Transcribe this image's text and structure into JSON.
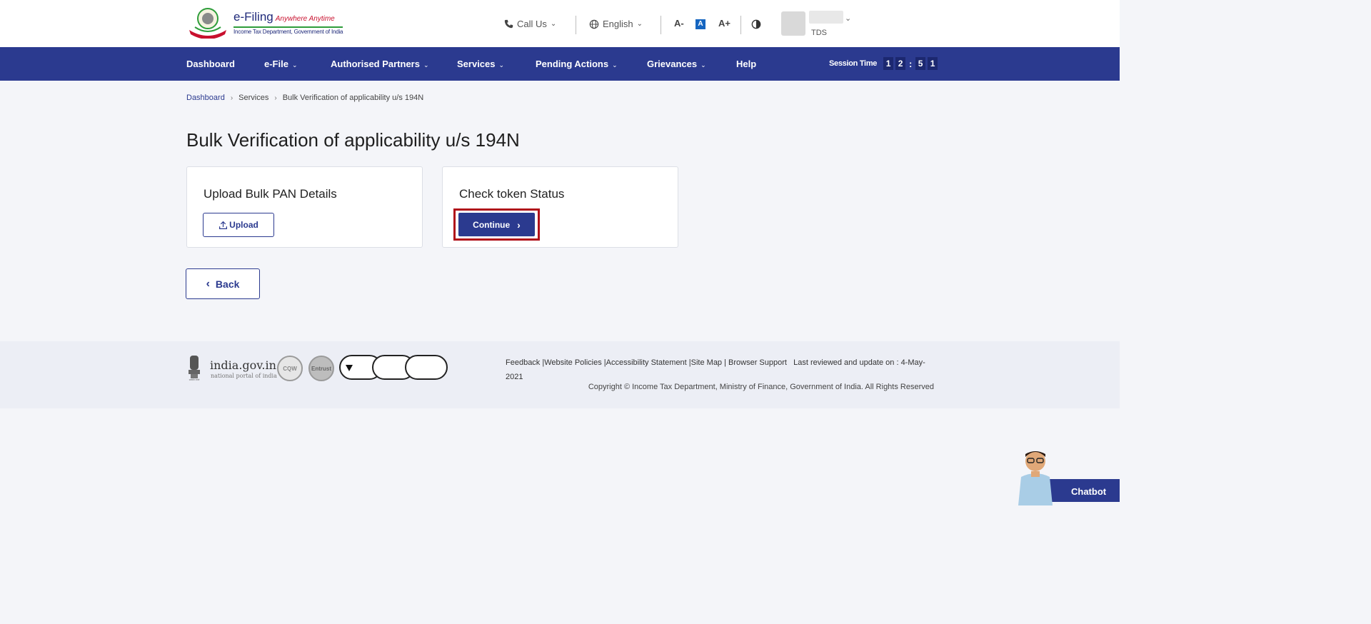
{
  "header": {
    "logo_title": "e-Filing",
    "logo_tagline": "Anywhere Anytime",
    "logo_subtitle": "Income Tax Department, Government of India",
    "call_us": "Call Us",
    "language": "English",
    "font_decrease": "A-",
    "font_normal": "A",
    "font_increase": "A+",
    "user_type": "TDS"
  },
  "nav": {
    "items": [
      {
        "label": "Dashboard",
        "has_menu": false
      },
      {
        "label": "e-File",
        "has_menu": true
      },
      {
        "label": "Authorised Partners",
        "has_menu": true
      },
      {
        "label": "Services",
        "has_menu": true
      },
      {
        "label": "Pending Actions",
        "has_menu": true
      },
      {
        "label": "Grievances",
        "has_menu": true
      },
      {
        "label": "Help",
        "has_menu": false
      }
    ],
    "session_label": "Session Time",
    "session_digits": [
      "1",
      "2",
      "5",
      "1"
    ]
  },
  "breadcrumb": {
    "home": "Dashboard",
    "services": "Services",
    "current": "Bulk Verification of applicability u/s 194N"
  },
  "page_title": "Bulk Verification of applicability u/s 194N",
  "cards": {
    "upload": {
      "title": "Upload Bulk PAN Details",
      "button": "Upload"
    },
    "token": {
      "title": "Check token Status",
      "button": "Continue"
    }
  },
  "back_button": "Back",
  "footer": {
    "india_gov": "india.gov.in",
    "india_gov_sub": "national portal of india",
    "badge_cqw": "CQW",
    "badge_entrust": "Entrust",
    "links": "Feedback |Website Policies |Accessibility Statement |Site Map | Browser Support",
    "last_reviewed": "Last reviewed and update on : 4-May-2021",
    "copyright": "Copyright © Income Tax Department, Ministry of Finance, Government of India. All Rights Reserved"
  },
  "chatbot": {
    "label": "Chatbot"
  },
  "colors": {
    "primary": "#2b3a8f",
    "highlight": "#b0101a"
  }
}
